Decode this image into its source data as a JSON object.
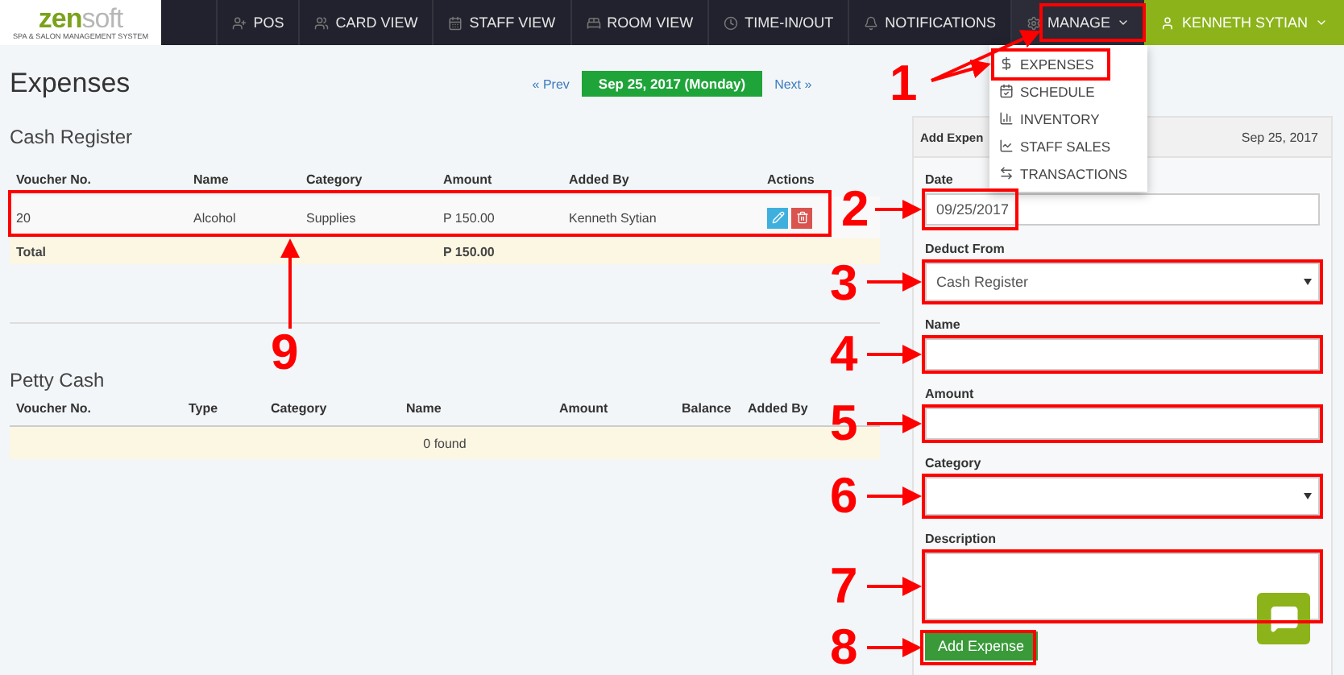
{
  "logo": {
    "parts": [
      "zen",
      "soft"
    ],
    "tagline": "SPA & SALON MANAGEMENT SYSTEM"
  },
  "nav": [
    {
      "label": "POS"
    },
    {
      "label": "CARD VIEW"
    },
    {
      "label": "STAFF VIEW"
    },
    {
      "label": "ROOM VIEW"
    },
    {
      "label": "TIME-IN/OUT"
    },
    {
      "label": "NOTIFICATIONS"
    }
  ],
  "manage": {
    "label": "MANAGE",
    "expanded": true,
    "items": [
      {
        "label": "EXPENSES"
      },
      {
        "label": "SCHEDULE"
      },
      {
        "label": "INVENTORY"
      },
      {
        "label": "STAFF SALES"
      },
      {
        "label": "TRANSACTIONS"
      }
    ]
  },
  "user": {
    "name": "KENNETH SYTIAN"
  },
  "page_title": "Expenses",
  "date_nav": {
    "prev": "« Prev",
    "date": "Sep 25, 2017 (Monday)",
    "next": "Next »"
  },
  "cash_register": {
    "title": "Cash Register",
    "columns": [
      "Voucher No.",
      "Name",
      "Category",
      "Amount",
      "Added By",
      "Actions"
    ],
    "rows": [
      {
        "cells": [
          "20",
          "Alcohol",
          "Supplies",
          "P 150.00",
          "Kenneth Sytian"
        ]
      }
    ],
    "total": {
      "label": "Total",
      "amount": "P 150.00"
    }
  },
  "petty_cash": {
    "title": "Petty Cash",
    "columns": [
      "Voucher No.",
      "Type",
      "Category",
      "Name",
      "Amount",
      "Balance",
      "Added By"
    ],
    "empty": "0 found"
  },
  "add_expense": {
    "title": "Add Expen",
    "date": "Sep 25, 2017",
    "fields": [
      {
        "kind": "input",
        "label": "Date",
        "value": "09/25/2017"
      },
      {
        "kind": "select",
        "label": "Deduct From",
        "value": "Cash Register"
      },
      {
        "kind": "input",
        "label": "Name"
      },
      {
        "kind": "input",
        "label": "Amount"
      },
      {
        "kind": "select",
        "label": "Category"
      },
      {
        "kind": "textarea",
        "label": "Description"
      }
    ],
    "button": "Add Expense"
  },
  "annotations": [
    {
      "label": "1"
    },
    {
      "label": "2"
    },
    {
      "label": "3"
    },
    {
      "label": "4"
    },
    {
      "label": "5"
    },
    {
      "label": "6"
    },
    {
      "label": "7"
    },
    {
      "label": "8"
    },
    {
      "label": "9"
    }
  ]
}
